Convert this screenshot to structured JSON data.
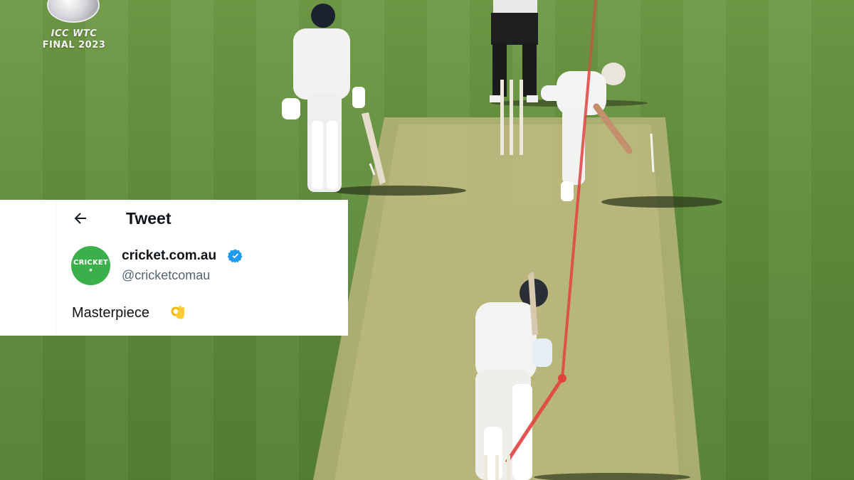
{
  "logo": {
    "line1": "ICC WTC",
    "line2": "FINAL 2023"
  },
  "tweet": {
    "header_title": "Tweet",
    "back_icon": "arrow-left-icon",
    "account_name": "cricket.com.au",
    "handle": "@cricketcomau",
    "verified_icon": "verified-badge-icon",
    "avatar_text": "CRICKET",
    "text": "Masterpiece",
    "emoji": "ok-hand-emoji"
  },
  "colors": {
    "twitter_blue": "#1d9bf0",
    "avatar_green": "#39b04a",
    "tracking_line_red": "#e2433f"
  }
}
